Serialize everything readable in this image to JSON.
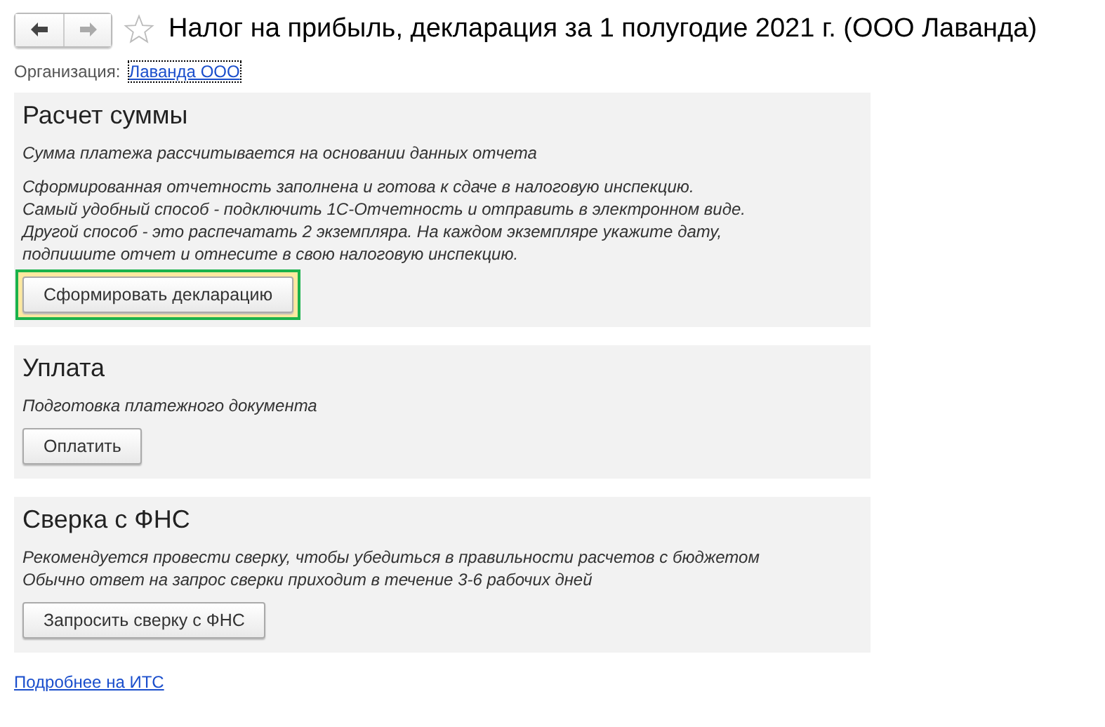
{
  "window": {
    "title": "Налог на прибыль, декларация за 1 полугодие 2021 г. (ООО Лаванда)",
    "favorite": false
  },
  "organization": {
    "label": "Организация:",
    "value": "Лаванда ООО"
  },
  "sections": [
    {
      "title": "Расчет суммы",
      "notes": [
        "Сумма платежа рассчитывается на основании данных отчета",
        "Сформированная отчетность заполнена и готова к сдаче в налоговую инспекцию.\nСамый удобный способ - подключить 1С-Отчетность и отправить в электронном виде.\nДругой способ - это распечатать 2 экземпляра. На каждом экземпляре укажите дату,\nподпишите отчет и отнесите в свою налоговую инспекцию."
      ],
      "button": {
        "label": "Сформировать декларацию",
        "highlighted": true
      }
    },
    {
      "title": "Уплата",
      "notes": [
        "Подготовка платежного документа"
      ],
      "button": {
        "label": "Оплатить",
        "highlighted": false
      }
    },
    {
      "title": "Сверка с ФНС",
      "notes": [
        "Рекомендуется провести сверку, чтобы убедиться в правильности расчетов с бюджетом\nОбычно ответ на запрос сверки приходит в течение 3-6 рабочих дней"
      ],
      "button": {
        "label": "Запросить сверку с ФНС",
        "highlighted": false
      }
    }
  ],
  "footer_link": "Подробнее на ИТС"
}
